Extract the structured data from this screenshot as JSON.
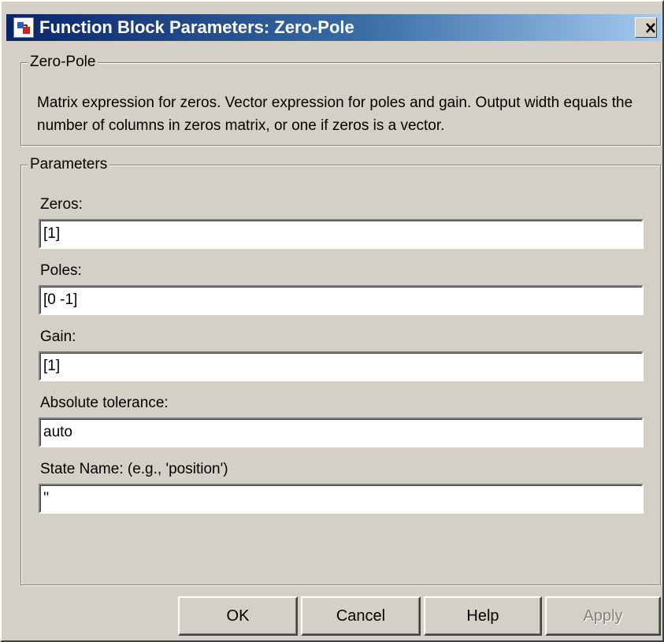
{
  "window": {
    "title": "Function Block Parameters: Zero-Pole",
    "close_glyph": "✕"
  },
  "description_group": {
    "legend": "Zero-Pole",
    "text": "Matrix expression for zeros.  Vector expression for poles and gain.  Output width equals the number of columns in zeros matrix, or one if zeros is a vector."
  },
  "parameters_group": {
    "legend": "Parameters",
    "fields": [
      {
        "label": "Zeros:",
        "value": "[1]"
      },
      {
        "label": "Poles:",
        "value": "[0 -1]"
      },
      {
        "label": "Gain:",
        "value": "[1]"
      },
      {
        "label": "Absolute tolerance:",
        "value": "auto"
      },
      {
        "label": "State Name: (e.g., 'position')",
        "value": "''"
      }
    ]
  },
  "buttons": {
    "ok": "OK",
    "cancel": "Cancel",
    "help": "Help",
    "apply": "Apply"
  },
  "colors": {
    "dialog_background": "#d4d0c8",
    "titlebar_start": "#0a246a",
    "titlebar_end": "#a6caf0",
    "disabled_text": "#808080"
  },
  "icons": {
    "app": "simulink-block-icon",
    "close": "close-icon"
  }
}
